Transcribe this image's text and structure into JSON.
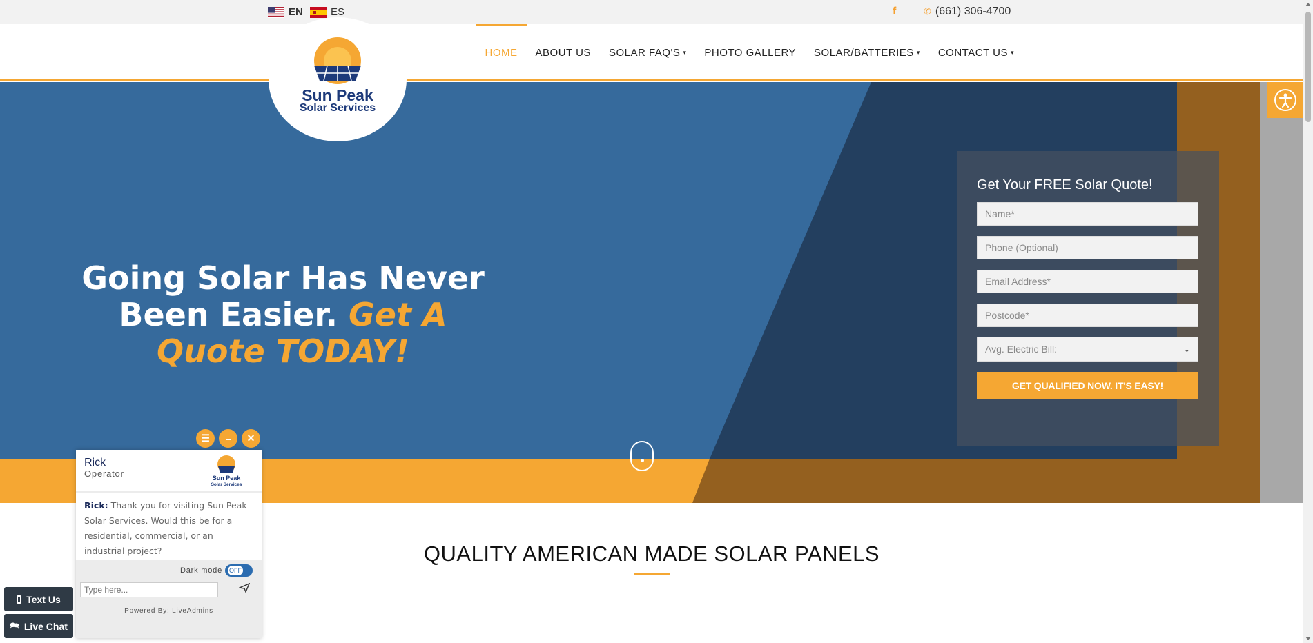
{
  "topbar": {
    "languages": [
      {
        "code": "EN",
        "flag": "us-flag"
      },
      {
        "code": "ES",
        "flag": "es-flag"
      }
    ],
    "facebook_icon": "f",
    "phone_icon": "✆",
    "phone": "(661) 306-4700"
  },
  "nav": {
    "items": [
      {
        "label": "HOME",
        "active": true
      },
      {
        "label": "ABOUT US"
      },
      {
        "label": "SOLAR FAQ'S",
        "dropdown": true
      },
      {
        "label": "PHOTO GALLERY"
      },
      {
        "label": "SOLAR/BATTERIES",
        "dropdown": true
      },
      {
        "label": "CONTACT US",
        "dropdown": true
      }
    ],
    "caret": "▾"
  },
  "logo": {
    "line1": "Sun Peak",
    "line2": "Solar Services"
  },
  "hero": {
    "headline_white_1": "Going Solar Has Never",
    "headline_white_2": "Been Easier.",
    "headline_accent_1": "Get A",
    "headline_accent_2": "Quote TODAY!"
  },
  "quote_form": {
    "title": "Get Your FREE Solar Quote!",
    "name_placeholder": "Name*",
    "phone_placeholder": "Phone (Optional)",
    "email_placeholder": "Email Address*",
    "postcode_placeholder": "Postcode*",
    "bill_select": "Avg. Electric Bill:",
    "submit": "GET QUALIFIED NOW. IT'S EASY!"
  },
  "section": {
    "title": "QUALITY AMERICAN MADE SOLAR PANELS"
  },
  "chat": {
    "controls": {
      "menu": "☰",
      "minimize": "–",
      "close": "✕"
    },
    "operator_name": "Rick",
    "operator_role": "Operator",
    "logo_line1": "Sun Peak",
    "logo_line2": "Solar Services",
    "msg_author": "Rick:",
    "msg_text": "Thank you for visiting Sun Peak Solar Services. Would this be for a residential, commercial, or an industrial project?",
    "dark_mode_label": "Dark mode",
    "toggle_state": "OFF",
    "input_placeholder": "Type here...",
    "powered_by": "Powered By: LiveAdmins"
  },
  "side_buttons": {
    "text_us": "Text Us",
    "live_chat": "Live Chat"
  },
  "colors": {
    "accent": "#f5a733",
    "hero_blue": "#366a9c",
    "hero_dark": "#233f5f",
    "navy": "#1d3a7a"
  }
}
